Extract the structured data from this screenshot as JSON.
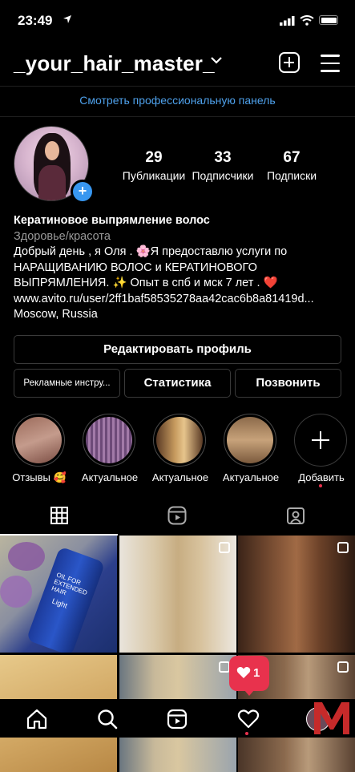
{
  "status_bar": {
    "time": "23:49"
  },
  "header": {
    "username": "_your_hair_master_"
  },
  "professional_dashboard": "Смотреть профессиональную панель",
  "stats": [
    {
      "value": "29",
      "label": "Публикации"
    },
    {
      "value": "33",
      "label": "Подписчики"
    },
    {
      "value": "67",
      "label": "Подписки"
    }
  ],
  "bio": {
    "name": "Кератиновое выпрямление волос",
    "category": "Здоровье/красота",
    "line1": "Добрый день , я Оля . 🌸Я предоставлю услуги по",
    "line2": "НАРАЩИВАНИЮ ВОЛОС и КЕРАТИНОВОГО",
    "line3": "ВЫПРЯМЛЕНИЯ. ✨ Опыт в спб и мск 7 лет . ❤️",
    "link": "www.avito.ru/user/2ff1baf58535278aa42cac6b8a81419d...",
    "location": "Moscow, Russia"
  },
  "buttons": {
    "edit_profile": "Редактировать профиль",
    "ad_tools": "Рекламные инстру...",
    "statistics": "Статистика",
    "call": "Позвонить"
  },
  "highlights": [
    {
      "label": "Отзывы 🥰"
    },
    {
      "label": "Актуальное"
    },
    {
      "label": "Актуальное"
    },
    {
      "label": "Актуальное"
    },
    {
      "label": "Добавить"
    }
  ],
  "grid_post_texts": {
    "bottle": "OIL FOR EXTENDED HAIR",
    "bottle_light": "Light"
  },
  "notification": {
    "likes": "1"
  },
  "colors": {
    "accent": "#3897f0",
    "link": "#4ea0ea",
    "notification": "#e8324d"
  },
  "icons": [
    "location-arrow-icon",
    "signal-icon",
    "wifi-icon",
    "battery-icon",
    "chevron-down-icon",
    "new-post-icon",
    "menu-icon",
    "grid-icon",
    "reels-icon",
    "tagged-icon",
    "home-icon",
    "search-icon",
    "heart-icon"
  ]
}
